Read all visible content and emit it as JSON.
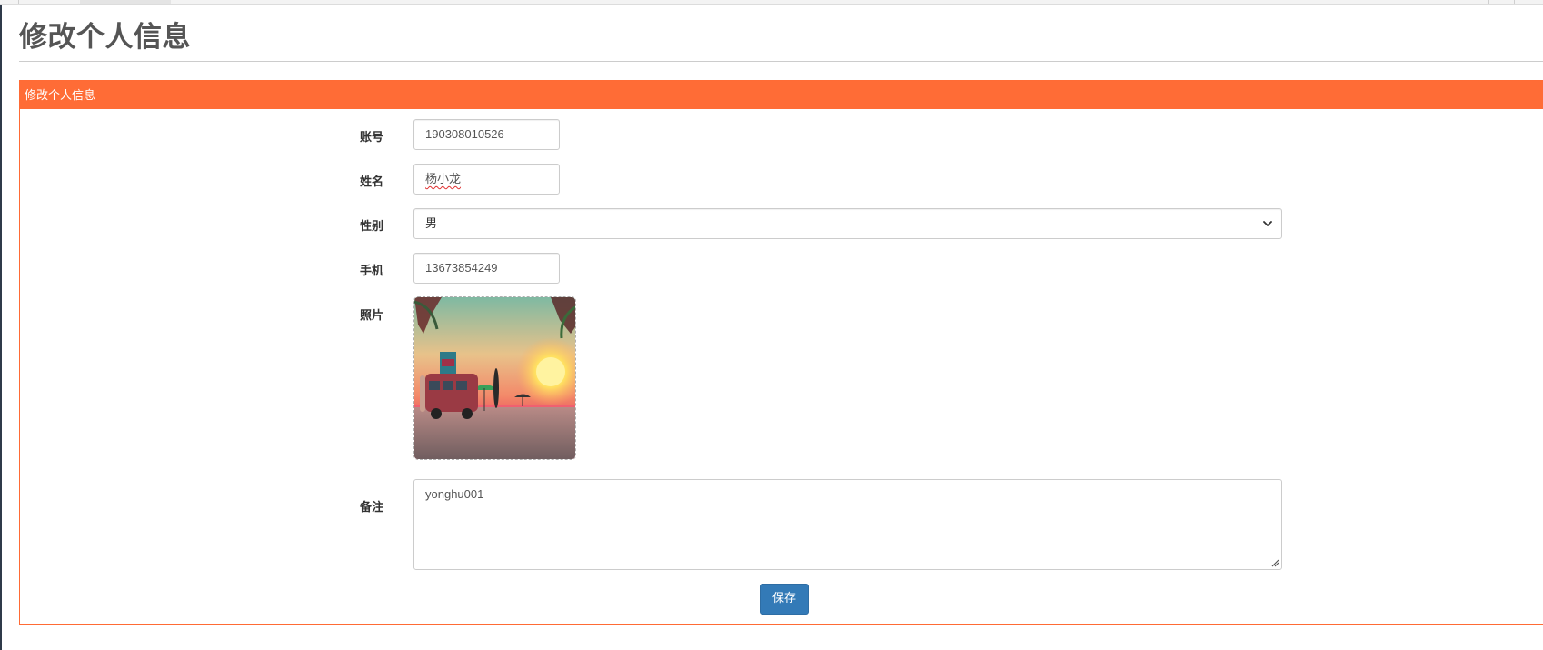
{
  "page": {
    "title": "修改个人信息"
  },
  "panel": {
    "heading": "修改个人信息",
    "accent_color": "#ff6c36"
  },
  "form": {
    "account": {
      "label": "账号",
      "value": "190308010526"
    },
    "name": {
      "label": "姓名",
      "value": "杨小龙"
    },
    "gender": {
      "label": "性别",
      "value": "男",
      "icon": "chevron-down-icon"
    },
    "phone": {
      "label": "手机",
      "value": "13673854249"
    },
    "photo": {
      "label": "照片",
      "image": "beach-sunset-photo"
    },
    "remark": {
      "label": "备注",
      "value": "yonghu001"
    }
  },
  "actions": {
    "save_label": "保存",
    "save_color": "#337ab7"
  }
}
